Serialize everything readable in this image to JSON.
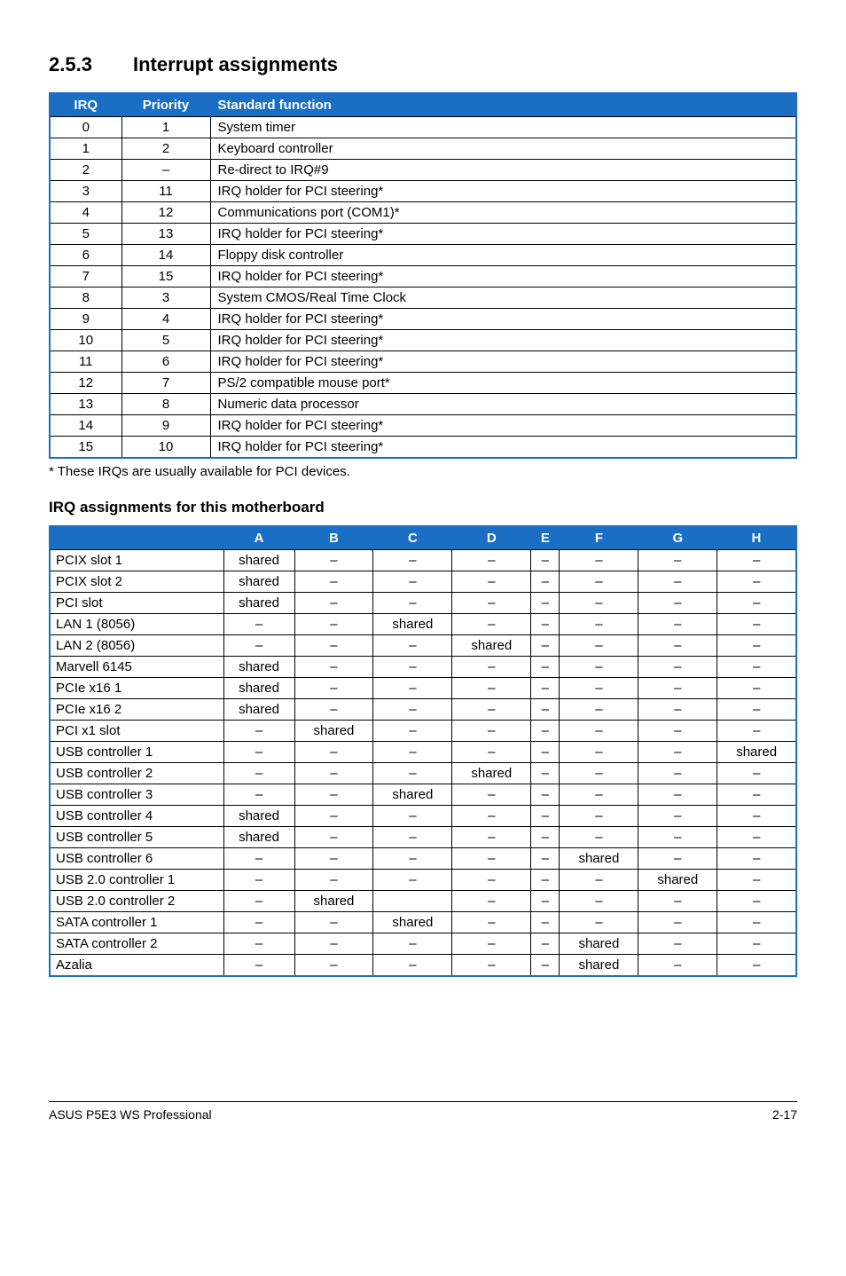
{
  "section": {
    "num": "2.5.3",
    "title": "Interrupt assignments"
  },
  "table1": {
    "headers": {
      "irq": "IRQ",
      "priority": "Priority",
      "func": "Standard function"
    },
    "rows": [
      {
        "irq": "0",
        "pri": "1",
        "func": "System timer"
      },
      {
        "irq": "1",
        "pri": "2",
        "func": "Keyboard controller"
      },
      {
        "irq": "2",
        "pri": "–",
        "func": "Re-direct to IRQ#9"
      },
      {
        "irq": "3",
        "pri": "11",
        "func": "IRQ holder for PCI steering*"
      },
      {
        "irq": "4",
        "pri": "12",
        "func": "Communications port (COM1)*"
      },
      {
        "irq": "5",
        "pri": "13",
        "func": "IRQ holder for PCI steering*"
      },
      {
        "irq": "6",
        "pri": "14",
        "func": "Floppy disk controller"
      },
      {
        "irq": "7",
        "pri": "15",
        "func": "IRQ holder for PCI steering*"
      },
      {
        "irq": "8",
        "pri": "3",
        "func": "System CMOS/Real Time Clock"
      },
      {
        "irq": "9",
        "pri": "4",
        "func": "IRQ holder for PCI steering*"
      },
      {
        "irq": "10",
        "pri": "5",
        "func": "IRQ holder for PCI steering*"
      },
      {
        "irq": "11",
        "pri": "6",
        "func": "IRQ holder for PCI steering*"
      },
      {
        "irq": "12",
        "pri": "7",
        "func": "PS/2 compatible mouse port*"
      },
      {
        "irq": "13",
        "pri": "8",
        "func": "Numeric data processor"
      },
      {
        "irq": "14",
        "pri": "9",
        "func": "IRQ holder for PCI steering*"
      },
      {
        "irq": "15",
        "pri": "10",
        "func": "IRQ holder for PCI steering*"
      }
    ]
  },
  "footnote": "* These IRQs are usually available for PCI devices.",
  "subhead": "IRQ assignments for this motherboard",
  "table2": {
    "headers": {
      "blank": "",
      "a": "A",
      "b": "B",
      "c": "C",
      "d": "D",
      "e": "E",
      "f": "F",
      "g": "G",
      "h": "H"
    },
    "rows": [
      {
        "lab": "PCIX slot 1",
        "a": "shared",
        "b": "–",
        "c": "–",
        "d": "–",
        "e": "–",
        "f": "–",
        "g": "–",
        "h": "–"
      },
      {
        "lab": "PCIX slot 2",
        "a": "shared",
        "b": "–",
        "c": "–",
        "d": "–",
        "e": "–",
        "f": "–",
        "g": "–",
        "h": "–"
      },
      {
        "lab": "PCI slot",
        "a": "shared",
        "b": "–",
        "c": "–",
        "d": "–",
        "e": "–",
        "f": "–",
        "g": "–",
        "h": "–"
      },
      {
        "lab": "LAN 1 (8056)",
        "a": "–",
        "b": "–",
        "c": "shared",
        "d": "–",
        "e": "–",
        "f": "–",
        "g": "–",
        "h": "–"
      },
      {
        "lab": "LAN 2 (8056)",
        "a": "–",
        "b": "–",
        "c": "–",
        "d": "shared",
        "e": "–",
        "f": "–",
        "g": "–",
        "h": "–"
      },
      {
        "lab": "Marvell 6145",
        "a": "shared",
        "b": "–",
        "c": "–",
        "d": "–",
        "e": "–",
        "f": "–",
        "g": "–",
        "h": "–"
      },
      {
        "lab": "PCIe x16 1",
        "a": "shared",
        "b": "–",
        "c": "–",
        "d": "–",
        "e": "–",
        "f": "–",
        "g": "–",
        "h": "–"
      },
      {
        "lab": "PCIe x16 2",
        "a": "shared",
        "b": "–",
        "c": "–",
        "d": "–",
        "e": "–",
        "f": "–",
        "g": "–",
        "h": "–"
      },
      {
        "lab": "PCI x1 slot",
        "a": "–",
        "b": "shared",
        "c": "–",
        "d": "–",
        "e": "–",
        "f": "–",
        "g": "–",
        "h": "–"
      },
      {
        "lab": "USB controller 1",
        "a": "–",
        "b": "–",
        "c": "–",
        "d": "–",
        "e": "–",
        "f": "–",
        "g": "–",
        "h": "shared"
      },
      {
        "lab": "USB controller 2",
        "a": "–",
        "b": "–",
        "c": "–",
        "d": "shared",
        "e": "–",
        "f": "–",
        "g": "–",
        "h": "–"
      },
      {
        "lab": "USB controller 3",
        "a": "–",
        "b": "–",
        "c": "shared",
        "d": "–",
        "e": "–",
        "f": "–",
        "g": "–",
        "h": "–"
      },
      {
        "lab": "USB controller 4",
        "a": "shared",
        "b": "–",
        "c": "–",
        "d": "–",
        "e": "–",
        "f": "–",
        "g": "–",
        "h": "–"
      },
      {
        "lab": "USB controller 5",
        "a": "shared",
        "b": "–",
        "c": "–",
        "d": "–",
        "e": "–",
        "f": "–",
        "g": "–",
        "h": "–"
      },
      {
        "lab": "USB controller 6",
        "a": "–",
        "b": "–",
        "c": "–",
        "d": "–",
        "e": "–",
        "f": "shared",
        "g": "–",
        "h": "–"
      },
      {
        "lab": "USB 2.0 controller 1",
        "a": "–",
        "b": "–",
        "c": "–",
        "d": "–",
        "e": "–",
        "f": "–",
        "g": "shared",
        "h": "–"
      },
      {
        "lab": "USB 2.0 controller 2",
        "a": "–",
        "b": "shared",
        "c": "",
        "d": "–",
        "e": "–",
        "f": "–",
        "g": "–",
        "h": "–"
      },
      {
        "lab": "SATA controller 1",
        "a": "–",
        "b": "–",
        "c": "shared",
        "d": "–",
        "e": "–",
        "f": "–",
        "g": "–",
        "h": "–"
      },
      {
        "lab": "SATA controller 2",
        "a": "–",
        "b": "–",
        "c": "–",
        "d": "–",
        "e": "–",
        "f": "shared",
        "g": "–",
        "h": "–"
      },
      {
        "lab": "Azalia",
        "a": "–",
        "b": "–",
        "c": "–",
        "d": "–",
        "e": "–",
        "f": "shared",
        "g": "–",
        "h": "–"
      }
    ]
  },
  "footer": {
    "left": "ASUS P5E3 WS Professional",
    "right": "2-17"
  }
}
